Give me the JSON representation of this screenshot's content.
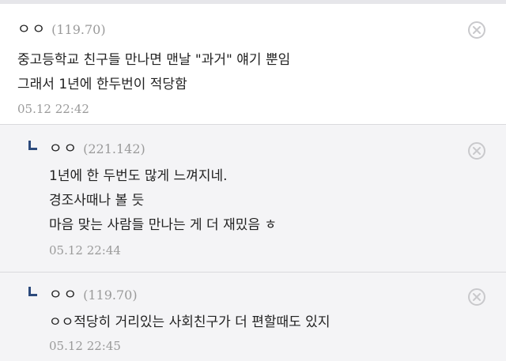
{
  "comments": [
    {
      "nickname": "ㅇㅇ",
      "ip": "(119.70)",
      "lines": [
        "중고등학교 친구들 만나면 맨날 \"과거\" 얘기 뿐임",
        "그래서 1년에 한두번이 적당함"
      ],
      "date": "05.12 22:42",
      "is_reply": false
    },
    {
      "nickname": "ㅇㅇ",
      "ip": "(221.142)",
      "lines": [
        "1년에 한 두번도 많게 느껴지네.",
        "경조사때나 볼 듯",
        "마음 맞는 사람들 만나는 게 더 재밌음 ㅎ"
      ],
      "date": "05.12 22:44",
      "is_reply": true
    },
    {
      "nickname": "ㅇㅇ",
      "ip": "(119.70)",
      "lines": [
        "ㅇㅇ적당히 거리있는 사회친구가 더 편할때도 있지"
      ],
      "date": "05.12 22:45",
      "is_reply": true
    }
  ],
  "icons": {
    "delete": "close-circle-icon",
    "reply": "reply-arrow-icon"
  },
  "colors": {
    "reply_bg": "#f4f4f6",
    "reply_mark": "#2c4a7c",
    "meta_gray": "#9a9a9a"
  }
}
